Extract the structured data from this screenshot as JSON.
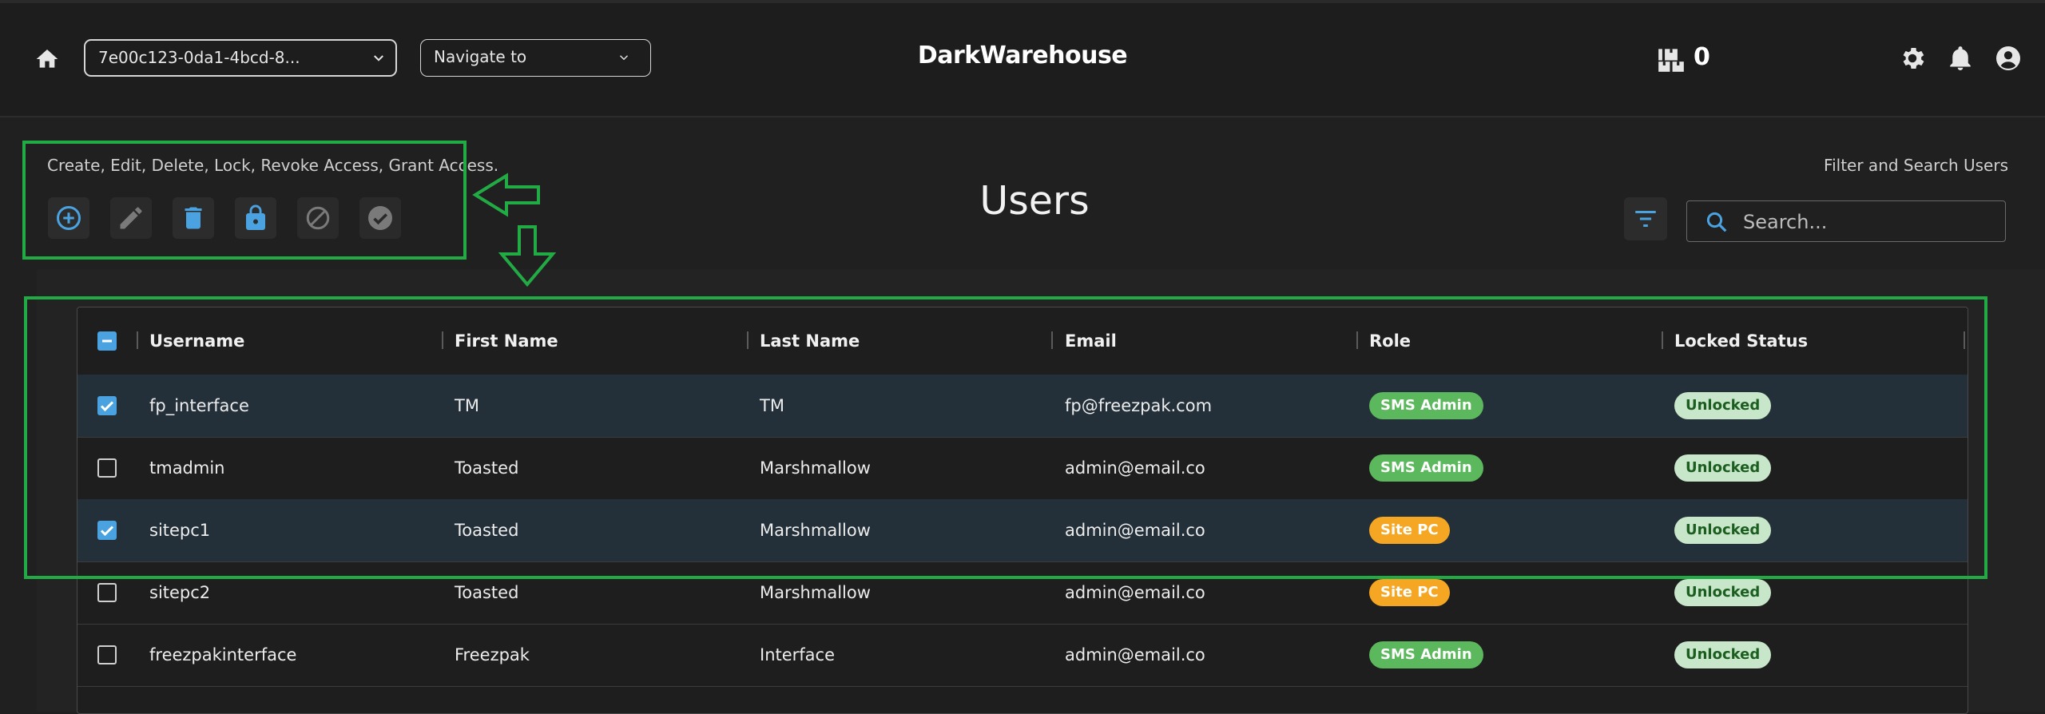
{
  "header": {
    "warehouse_select_value": "7e00c123-0da1-4bcd-8...",
    "navigate_placeholder": "Navigate to",
    "brand": "DarkWarehouse",
    "cart_count": "0",
    "icons": [
      "home-icon",
      "chevron-down-icon",
      "warehouse-boxes-icon",
      "gear-icon",
      "bell-icon",
      "account-icon"
    ]
  },
  "toolbar": {
    "description": "Create, Edit, Delete, Lock, Revoke Access, Grant Access.",
    "buttons": [
      "add-circle-icon",
      "pencil-icon",
      "trash-icon",
      "lock-icon",
      "block-icon",
      "check-circle-icon"
    ]
  },
  "page": {
    "title": "Users",
    "filter_hint": "Filter and Search Users",
    "search_placeholder": "Search..."
  },
  "table": {
    "columns": [
      "Username",
      "First Name",
      "Last Name",
      "Email",
      "Role",
      "Locked Status"
    ],
    "rows": [
      {
        "checked": true,
        "username": "fp_interface",
        "first": "TM",
        "last": "TM",
        "email": "fp@freezpak.com",
        "role": "SMS Admin",
        "status": "Unlocked"
      },
      {
        "checked": false,
        "username": "tmadmin",
        "first": "Toasted",
        "last": "Marshmallow",
        "email": "admin@email.co",
        "role": "SMS Admin",
        "status": "Unlocked"
      },
      {
        "checked": true,
        "username": "sitepc1",
        "first": "Toasted",
        "last": "Marshmallow",
        "email": "admin@email.co",
        "role": "Site PC",
        "status": "Unlocked"
      },
      {
        "checked": false,
        "username": "sitepc2",
        "first": "Toasted",
        "last": "Marshmallow",
        "email": "admin@email.co",
        "role": "Site PC",
        "status": "Unlocked"
      },
      {
        "checked": false,
        "username": "freezpakinterface",
        "first": "Freezpak",
        "last": "Interface",
        "email": "admin@email.co",
        "role": "SMS Admin",
        "status": "Unlocked"
      }
    ]
  },
  "colors": {
    "accent": "#4aa3e0",
    "role_sms_admin": "#5cb85c",
    "role_site_pc": "#f5a623",
    "status_unlocked_bg": "#c8e6c9",
    "status_unlocked_text": "#1b5e20",
    "annotation_green": "#22aa44",
    "selected_row": "#243039"
  }
}
